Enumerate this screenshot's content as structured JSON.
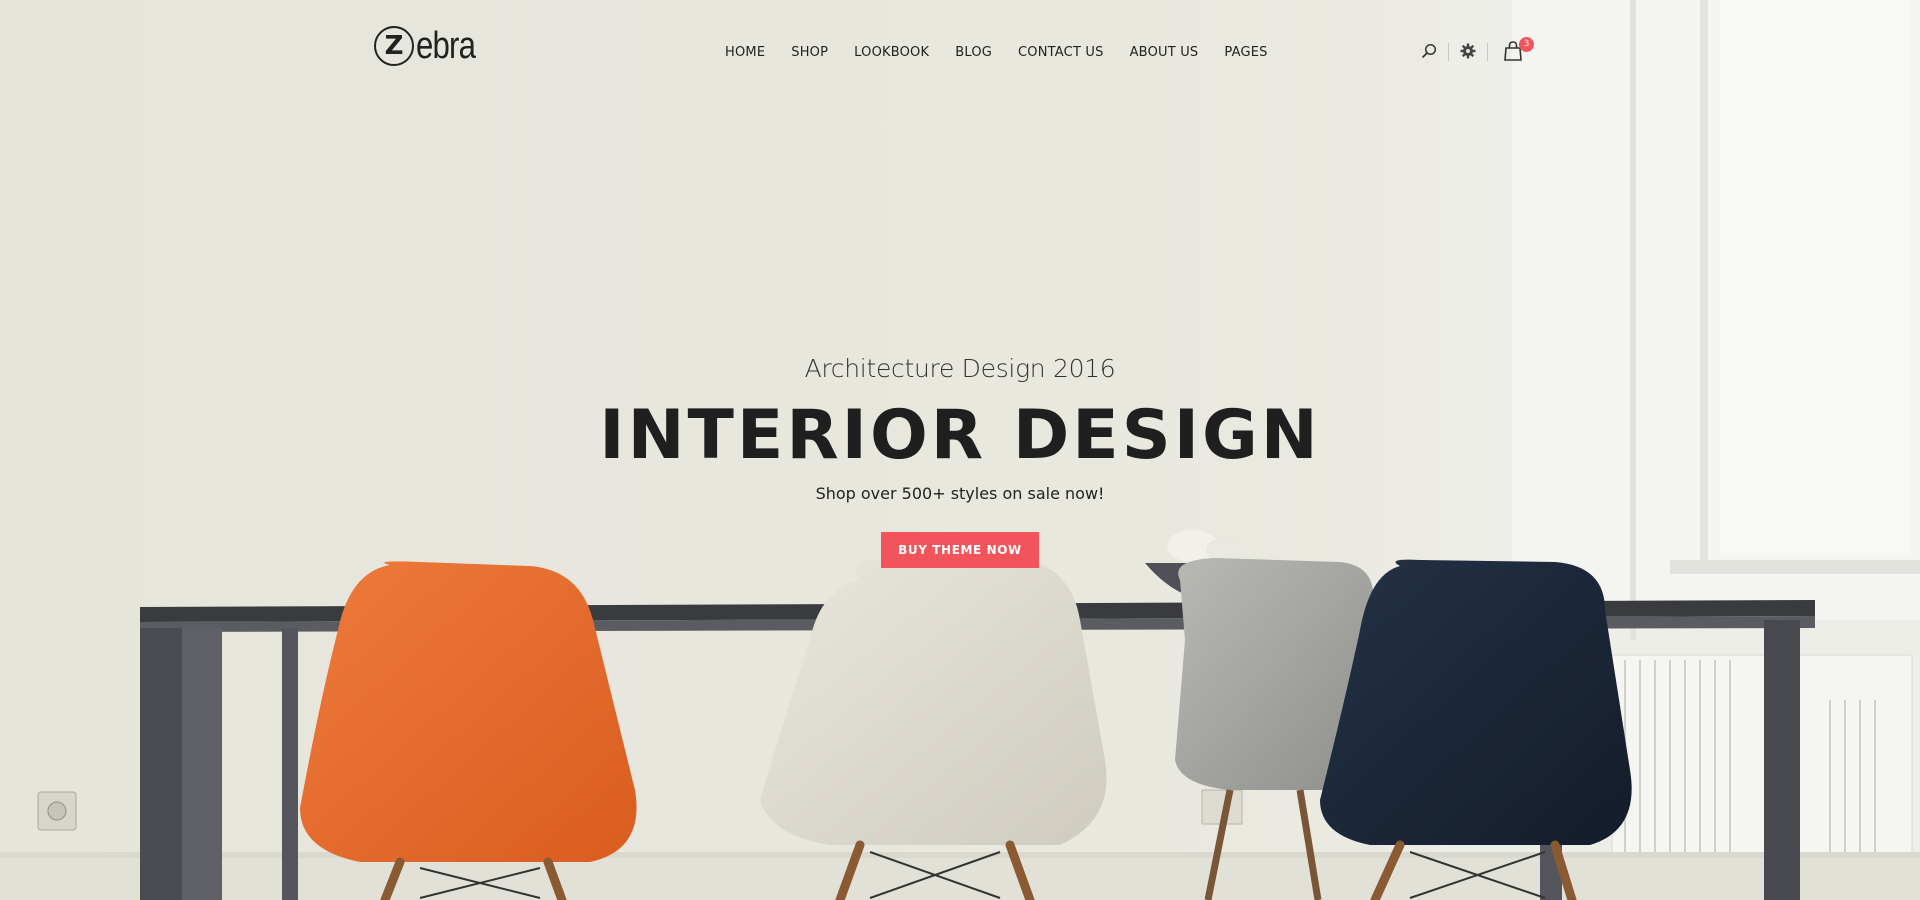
{
  "brand": {
    "logo_mark": "Z",
    "logo_text": "ebra"
  },
  "nav": {
    "items": [
      {
        "label": "HOME"
      },
      {
        "label": "SHOP"
      },
      {
        "label": "LOOKBOOK"
      },
      {
        "label": "BLOG"
      },
      {
        "label": "CONTACT US"
      },
      {
        "label": "ABOUT US"
      },
      {
        "label": "PAGES"
      }
    ]
  },
  "tools": {
    "search_icon": "search-icon",
    "settings_icon": "gear-icon",
    "cart_icon": "shopping-bag-icon",
    "cart_count": "3"
  },
  "hero": {
    "kicker": "Architecture Design 2016",
    "title": "INTERIOR DESIGN",
    "subtitle": "Shop over 500+ styles on sale now!",
    "cta_label": "BUY THEME NOW"
  },
  "colors": {
    "accent": "#f2545b",
    "text": "#222222",
    "wall": "#e7e6dd"
  }
}
